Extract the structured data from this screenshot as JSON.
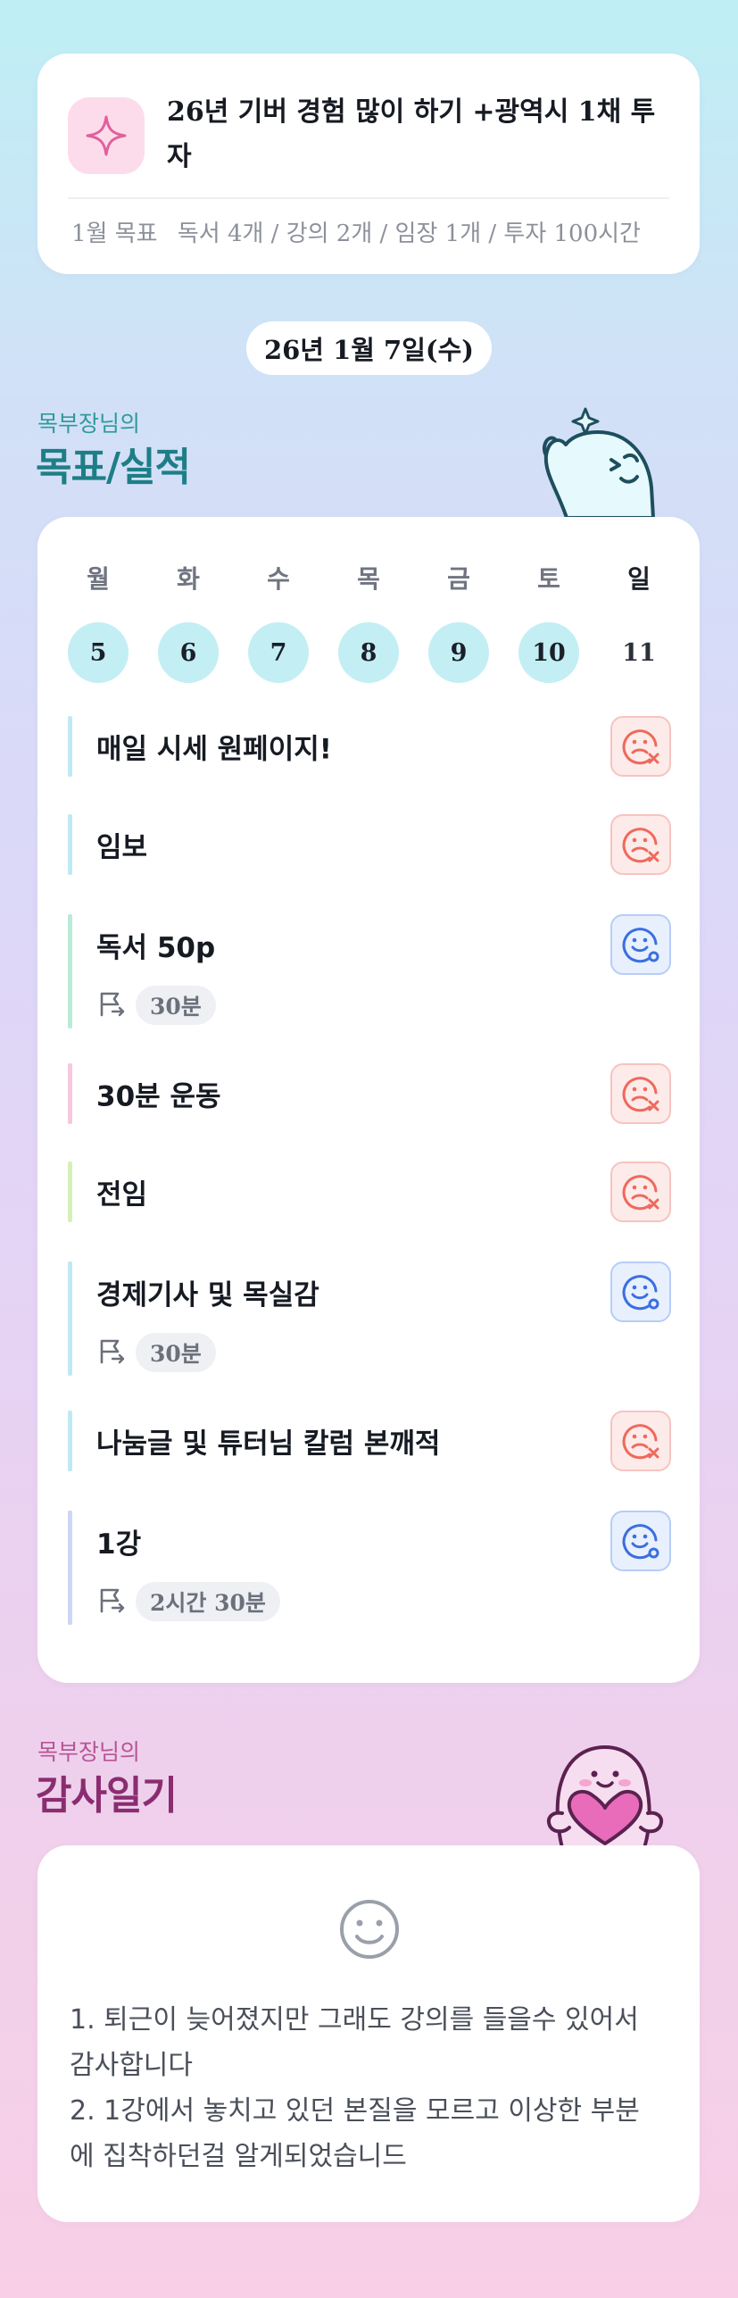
{
  "goal": {
    "title": "26년 기버 경험 많이 하기 +광역시 1채 투자",
    "month_label": "1월 목표",
    "month_goals": "독서 4개 / 강의 2개 / 임장 1개 / 투자 100시간",
    "icon": "sparkle-icon"
  },
  "date": "26년 1월 7일(수)",
  "goals_section": {
    "owner": "목부장님의",
    "title": "목표/실적"
  },
  "week": {
    "days": [
      "월",
      "화",
      "수",
      "목",
      "금",
      "토",
      "일"
    ],
    "dates": [
      "5",
      "6",
      "7",
      "8",
      "9",
      "10",
      "11"
    ]
  },
  "tasks": [
    {
      "name": "매일 시세 원페이지!",
      "status": "fail",
      "color": "#bfeaf4"
    },
    {
      "name": "임보",
      "status": "fail",
      "color": "#bfeaf4"
    },
    {
      "name": "독서 50p",
      "status": "ok",
      "color": "#b8ecd6",
      "time": "30분"
    },
    {
      "name": "30분 운동",
      "status": "fail",
      "color": "#f8c7df"
    },
    {
      "name": "전임",
      "status": "fail",
      "color": "#d6f0b6"
    },
    {
      "name": "경제기사 및 목실감",
      "status": "ok",
      "color": "#bfeaf4",
      "time": "30분"
    },
    {
      "name": "나눔글 및 튜터님 칼럼 본깨적",
      "status": "fail",
      "color": "#bfeaf4"
    },
    {
      "name": "1강",
      "status": "ok",
      "color": "#cdd6f7",
      "time": "2시간 30분"
    }
  ],
  "thanks_section": {
    "owner": "목부장님의",
    "title": "감사일기"
  },
  "thanks": {
    "lines": [
      "1. 퇴근이 늦어졌지만 그래도 강의를 들을수 있어서",
      "감사합니다",
      "2. 1강에서 놓치고 있던 본질을 모르고 이상한 부분",
      "에 집착하던걸 알게되었습니드"
    ]
  },
  "colors": {
    "fail_red": "#ee6a5c",
    "ok_blue": "#3b6fe0",
    "teal_title": "#1e7e86",
    "plum_title": "#8a2d70"
  }
}
